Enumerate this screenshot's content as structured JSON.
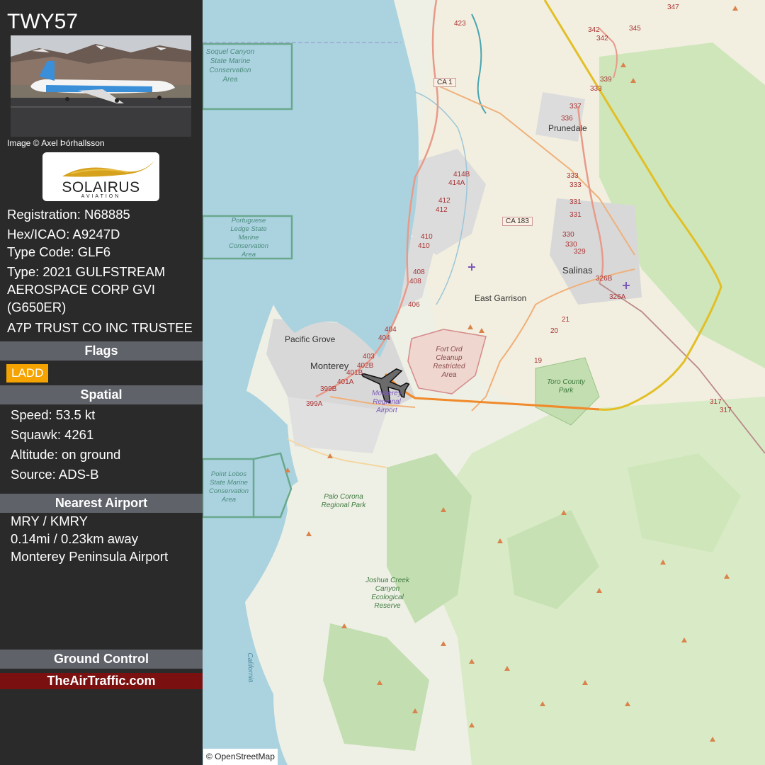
{
  "callsign": "TWY57",
  "photo_credit": "Image © Axel Þórhallsson",
  "operator_logo": {
    "name": "SOLAIRUS",
    "sub": "AVIATION"
  },
  "aircraft": {
    "registration": "Registration: N68885",
    "hex": "Hex/ICAO: A9247D",
    "type_code": "Type Code: GLF6",
    "type": "Type: 2021 GULFSTREAM AEROSPACE CORP GVI (G650ER)",
    "owner": "A7P TRUST CO INC TRUSTEE"
  },
  "sections": {
    "flags": "Flags",
    "spatial": "Spatial",
    "nearest_airport": "Nearest Airport",
    "ground_control": "Ground Control"
  },
  "flags": [
    "LADD"
  ],
  "spatial": {
    "speed": "Speed: 53.5 kt",
    "squawk": "Squawk: 4261",
    "altitude": "Altitude: on ground",
    "source": "Source: ADS-B"
  },
  "nearest_airport": {
    "codes": "MRY / KMRY",
    "distance": "0.14mi / 0.23km away",
    "name": "Monterey Peninsula Airport"
  },
  "brand": "TheAirTraffic.com",
  "attribution": "© OpenStreetMap",
  "colors": {
    "sidebar_bg": "#2a2a2a",
    "section_header": "#5f6268",
    "flag_badge": "#f5a300",
    "brand_bar": "#7b1010",
    "sea": "#aad3df",
    "track_recent": "#f08a2a",
    "track_old": "#e2bf25"
  },
  "map": {
    "places": {
      "monterey": "Monterey",
      "pacific_grove": "Pacific Grove",
      "salinas": "Salinas",
      "prunedale": "Prunedale",
      "east_garrison": "East Garrison"
    },
    "areas": {
      "soquel": "Soquel Canyon State Marine Conservation Area",
      "portuguese": "Portuguese Ledge State Marine Conservation Area",
      "fort_ord": "Fort Ord Cleanup Restricted Area",
      "toro": "Toro County Park",
      "point_lobos": "Point Lobos State Marine Conservation Area",
      "palo_corona": "Palo Corona Regional Park",
      "joshua_creek": "Joshua Creek Canyon Ecological Reserve",
      "airport": "Monterey Regional Airport",
      "california": "California"
    },
    "route_shields": [
      "CA 1",
      "CA 183"
    ],
    "exit_numbers": [
      "423",
      "414B",
      "414A",
      "412",
      "412",
      "410",
      "410",
      "408",
      "408",
      "406",
      "404",
      "404",
      "403",
      "402B",
      "401B",
      "401A",
      "399B",
      "399A",
      "337",
      "336",
      "333",
      "333",
      "331",
      "331",
      "330",
      "330",
      "329",
      "326B",
      "326A",
      "342",
      "342",
      "345",
      "347",
      "339",
      "333",
      "21",
      "20",
      "19",
      "317",
      "317"
    ]
  }
}
